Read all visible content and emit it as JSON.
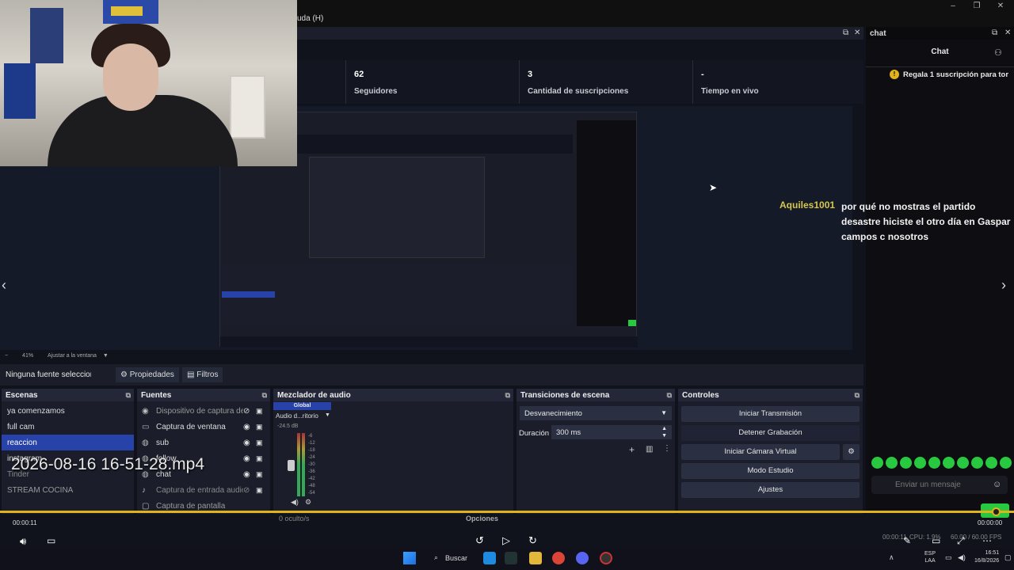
{
  "menubar": {
    "help_label": "uda (H)"
  },
  "chat": {
    "dock_title": "chat",
    "tab_title": "Chat",
    "pinned_gift": "Regala 1 suscripción para tor",
    "message": {
      "user": "Aquiles1001",
      "text": "por qué no mostras el partido desastre hiciste el otro día en Gaspar campos c nosotros"
    },
    "input_placeholder": "Enviar un mensaje"
  },
  "stats": [
    {
      "value": "",
      "label": ""
    },
    {
      "value": "62",
      "label": "Seguidores"
    },
    {
      "value": "3",
      "label": "Cantidad de suscripciones"
    },
    {
      "value": "-",
      "label": "Tiempo en vivo"
    }
  ],
  "preview": {
    "zoom": "41%",
    "fit_label": "Ajustar a la ventana"
  },
  "properties_bar": {
    "no_source": "Ninguna fuente seleccionad",
    "properties": "Propiedades",
    "filters": "Filtros"
  },
  "scenes": {
    "title": "Escenas",
    "items": [
      "ya comenzamos",
      "full cam",
      "reaccion",
      "instagram",
      "Tinder",
      "STREAM COCINA"
    ],
    "selected_index": 2
  },
  "sources": {
    "title": "Fuentes",
    "items": [
      {
        "name": "Dispositivo de captura de",
        "icon": "camera-icon",
        "visible": false
      },
      {
        "name": "Captura de ventana",
        "icon": "window-icon",
        "visible": true
      },
      {
        "name": "sub",
        "icon": "globe-icon",
        "visible": true
      },
      {
        "name": "follow",
        "icon": "globe-icon",
        "visible": true
      },
      {
        "name": "chat",
        "icon": "globe-icon",
        "visible": true
      },
      {
        "name": "Captura de entrada audio",
        "icon": "mic-icon",
        "visible": false
      },
      {
        "name": "Captura de pantalla",
        "icon": "monitor-icon",
        "visible": false
      }
    ]
  },
  "mixer": {
    "title": "Mezclador de audio",
    "tab": "Global",
    "channel": "Audio d...ritorio",
    "level": "-24.5 dB",
    "scale": [
      "-6",
      "-12",
      "-18",
      "-24",
      "-30",
      "-36",
      "-42",
      "-48",
      "-54"
    ],
    "hidden": "0 oculto/s",
    "options": "Opciones"
  },
  "transitions": {
    "title": "Transiciones de escena",
    "type": "Desvanecimiento",
    "duration_label": "Duración",
    "duration": "300 ms"
  },
  "controls": {
    "title": "Controles",
    "buttons": [
      "Iniciar Transmisión",
      "Detener Grabación",
      "Iniciar Cámara Virtual",
      "Modo Estudio",
      "Ajustes"
    ]
  },
  "video": {
    "filename": "2026-08-16 16-51-28.mp4",
    "time_current": "00:00:11",
    "time_total": "00:00:00",
    "progress": 0.99
  },
  "status": {
    "cpu": "CPU: 1.9%",
    "fps": "60.00 / 60.00 FPS",
    "rec_time": "00:00:11",
    "stream_time": "00:00:00"
  },
  "taskbar": {
    "search": "Buscar",
    "lang": "ESP",
    "lang2": "LAA",
    "time": "16:51",
    "date": "16/8/2026"
  }
}
